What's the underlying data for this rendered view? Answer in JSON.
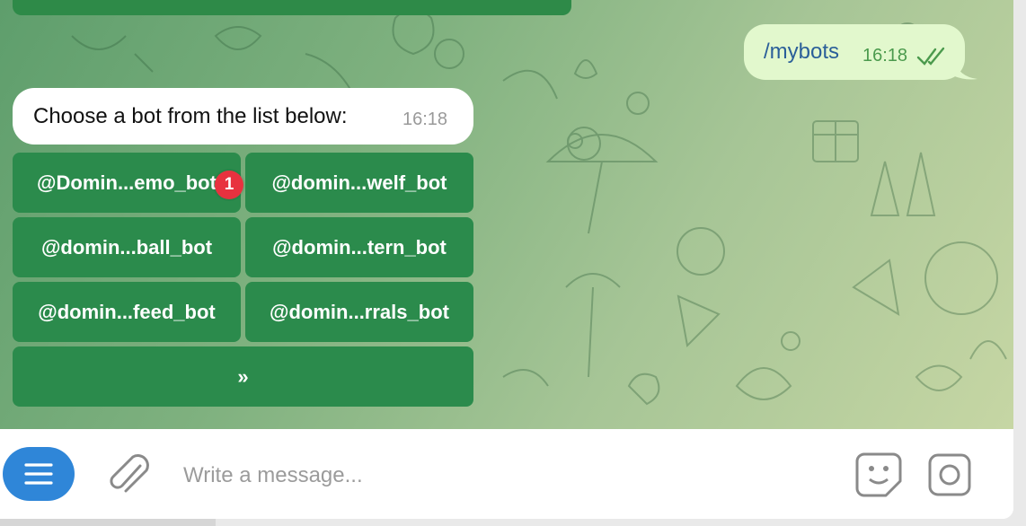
{
  "top_partial_button": {
    "label": ""
  },
  "outgoing_message": {
    "text": "/mybots",
    "time": "16:18",
    "status_icon": "double-check-icon"
  },
  "incoming_message": {
    "text": "Choose a bot from the list below:",
    "time": "16:18"
  },
  "keyboard": {
    "buttons": [
      {
        "label": "@Domin...emo_bot",
        "badge": "1"
      },
      {
        "label": "@domin...welf_bot"
      },
      {
        "label": "@domin...ball_bot"
      },
      {
        "label": "@domin...tern_bot"
      },
      {
        "label": "@domin...feed_bot"
      },
      {
        "label": "@domin...rrals_bot"
      }
    ],
    "next_label": "»"
  },
  "composer": {
    "placeholder": "Write a message...",
    "menu_icon": "menu-icon",
    "attach_icon": "paperclip-icon",
    "sticker_icon": "sticker-icon",
    "camera_icon": "camera-icon"
  },
  "colors": {
    "accent": "#2f86d8",
    "keyboard_button": "#2b8b4c",
    "outgoing_bubble": "#e2f8cd",
    "badge": "#e8323f"
  }
}
